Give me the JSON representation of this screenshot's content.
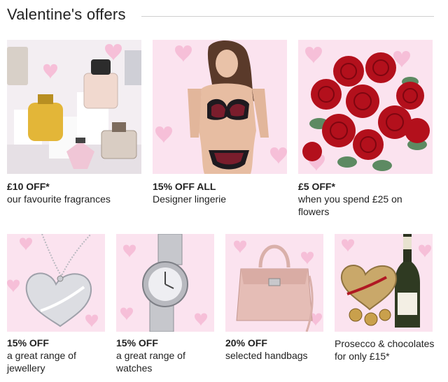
{
  "header": {
    "title": "Valentine's offers"
  },
  "offers": [
    {
      "headline": "£10 OFF*",
      "description": "our favourite fragrances",
      "image_icon": "fragrance-bottles"
    },
    {
      "headline": "15% OFF ALL",
      "description": "Designer lingerie",
      "image_icon": "lingerie-model"
    },
    {
      "headline": "£5 OFF*",
      "description": "when you spend £25 on flowers",
      "image_icon": "red-roses-bouquet"
    },
    {
      "headline": "15% OFF",
      "description": "a great range of jewellery",
      "image_icon": "heart-pendant-necklace"
    },
    {
      "headline": "15% OFF",
      "description": "a great range of watches",
      "image_icon": "silver-watch"
    },
    {
      "headline": "20% OFF",
      "description": "selected handbags",
      "image_icon": "pink-handbag"
    },
    {
      "headline": "",
      "description": "Prosecco & chocolates for only £15*",
      "image_icon": "prosecco-and-chocolates"
    }
  ],
  "colors": {
    "tile_background": "#fbe3ef",
    "heart": "#f6bfd8",
    "rose": "#b3101c",
    "text": "#222222"
  }
}
